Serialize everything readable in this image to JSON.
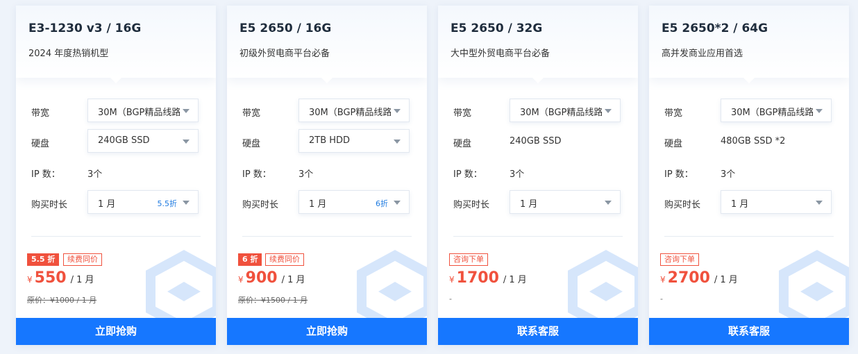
{
  "cards": [
    {
      "title": "E3-1230 v3 / 16G",
      "subtitle": "2024 年度热销机型",
      "labels": {
        "bandwidth": "带宽",
        "disk": "硬盘",
        "ip": "IP 数：",
        "duration": "购买时长"
      },
      "bandwidth": "30M（BGP精品线路）",
      "disk": "240GB SSD",
      "ip": "3个",
      "duration": "1 月",
      "duration_discount": "5.5折",
      "badge": "5.5 折",
      "badge2": "续费同价",
      "currency": "¥",
      "price": "550",
      "unit": "/ 1 月",
      "original": "原价：¥1000 / 1 月",
      "button": "立即抢购"
    },
    {
      "title": "E5 2650 / 16G",
      "subtitle": "初级外贸电商平台必备",
      "labels": {
        "bandwidth": "带宽",
        "disk": "硬盘",
        "ip": "IP 数：",
        "duration": "购买时长"
      },
      "bandwidth": "30M（BGP精品线路）",
      "disk": "2TB HDD",
      "ip": "3个",
      "duration": "1 月",
      "duration_discount": "6折",
      "badge": "6 折",
      "badge2": "续费同价",
      "currency": "¥",
      "price": "900",
      "unit": "/ 1 月",
      "original": "原价：¥1500 / 1 月",
      "button": "立即抢购"
    },
    {
      "title": "E5 2650 / 32G",
      "subtitle": "大中型外贸电商平台必备",
      "labels": {
        "bandwidth": "带宽",
        "disk": "硬盘",
        "ip": "IP 数：",
        "duration": "购买时长"
      },
      "bandwidth": "30M（BGP精品线路）",
      "disk": "240GB SSD",
      "ip": "3个",
      "duration": "1 月",
      "badge_inquiry": "咨询下单",
      "currency": "¥",
      "price": "1700",
      "unit": "/ 1 月",
      "original": "-",
      "button": "联系客服"
    },
    {
      "title": "E5 2650*2 / 64G",
      "subtitle": "高并发商业应用首选",
      "labels": {
        "bandwidth": "带宽",
        "disk": "硬盘",
        "ip": "IP 数：",
        "duration": "购买时长"
      },
      "bandwidth": "30M（BGP精品线路）",
      "disk": "480GB SSD *2",
      "ip": "3个",
      "duration": "1 月",
      "badge_inquiry": "咨询下单",
      "currency": "¥",
      "price": "2700",
      "unit": "/ 1 月",
      "original": "-",
      "button": "联系客服"
    }
  ]
}
